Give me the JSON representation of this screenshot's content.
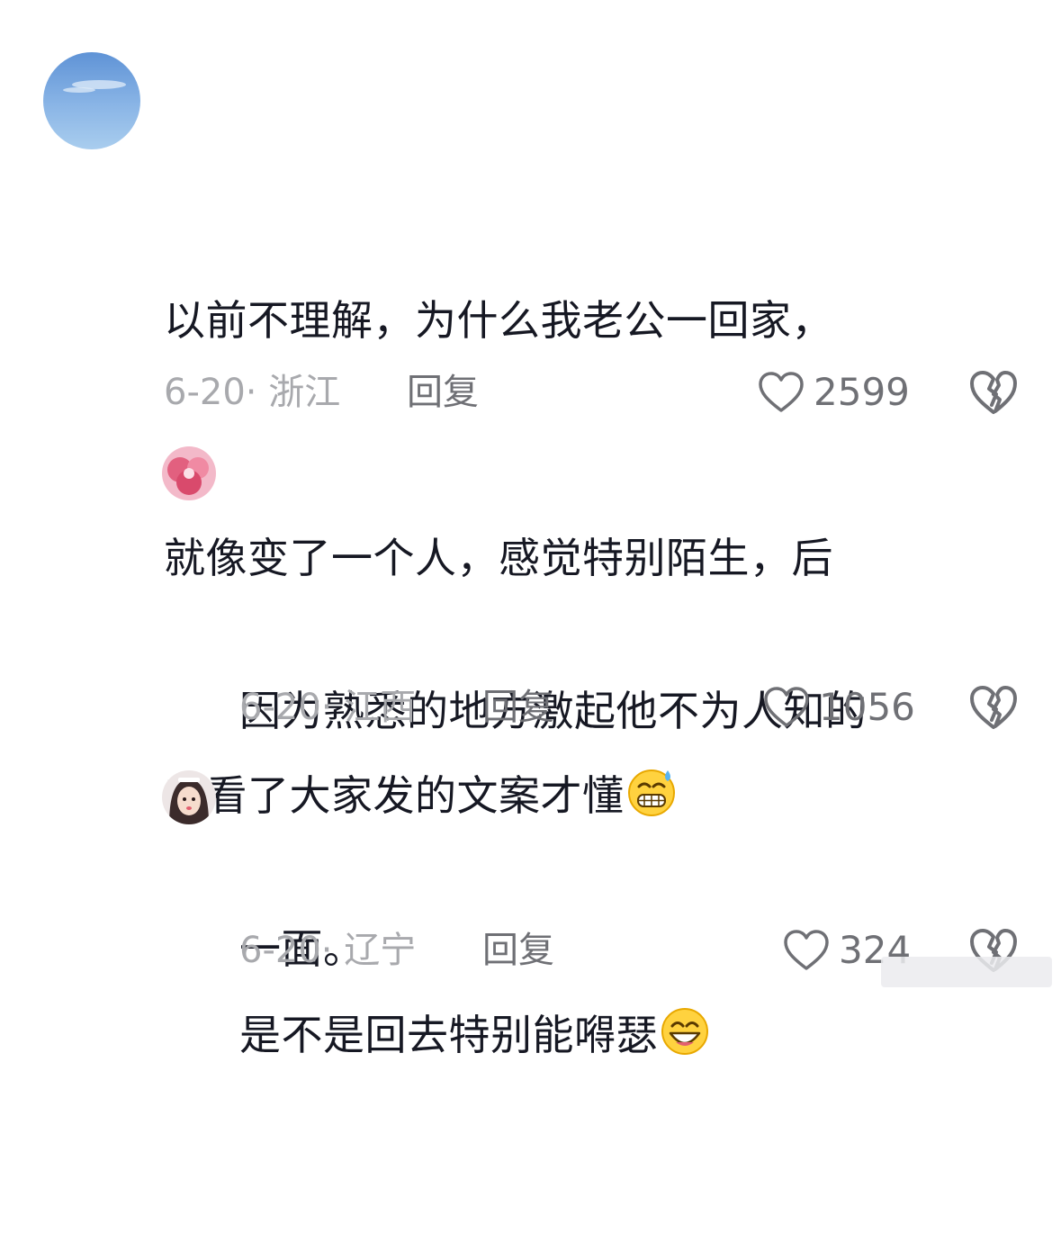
{
  "comments": [
    {
      "avatar_icon": "sky-avatar",
      "text_lines": [
        "以前不理解，为什么我老公一回家，",
        "就像变了一个人，感觉特别陌生，后",
        "来看了大家发的文案才懂"
      ],
      "emoji_icon": "grimacing-sweat-emoji",
      "date_location": "6-20· 浙江",
      "reply_label": "回复",
      "like_count": "2599"
    },
    {
      "avatar_icon": "pink-flower-avatar",
      "text_lines": [
        "因为熟悉的地方激起他不为人知的",
        "一面。"
      ],
      "emoji_icon": "",
      "date_location": "6-20· 江西",
      "reply_label": "回复",
      "like_count": "1056"
    },
    {
      "avatar_icon": "girl-portrait-avatar",
      "text_lines": [
        "是不是回去特别能嘚瑟"
      ],
      "emoji_icon": "grinning-emoji",
      "date_location": "6-20· 辽宁",
      "reply_label": "回复",
      "like_count": "324"
    }
  ],
  "colors": {
    "text": "#161823",
    "meta": "#a8a9ad",
    "action": "#6f7075"
  }
}
